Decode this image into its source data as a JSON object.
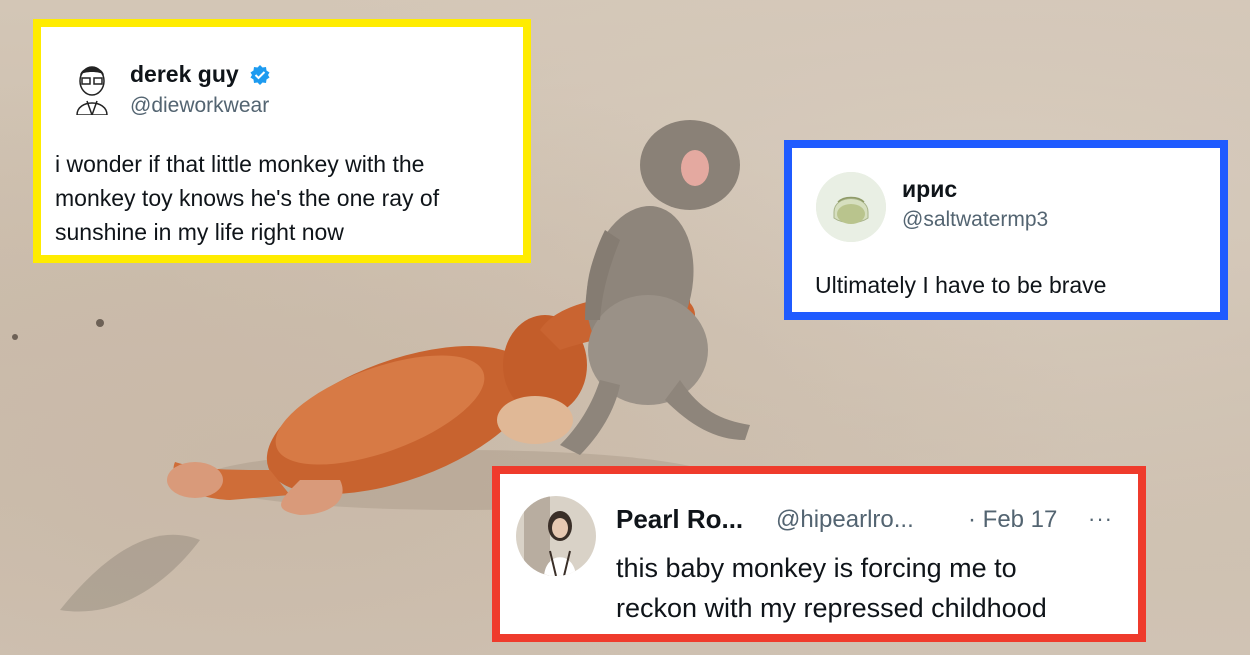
{
  "tweets": {
    "derek": {
      "name": "derek guy",
      "handle": "@dieworkwear",
      "text_lines": [
        "i wonder if that little monkey with the",
        "monkey toy knows he's the one ray of",
        "sunshine in my life right now"
      ],
      "verified": true,
      "border_color": "#ffec00"
    },
    "iris": {
      "name": "ирис",
      "handle": "@saltwatermp3",
      "text": "Ultimately I have to be brave",
      "border_color": "#1f5bff"
    },
    "pearl": {
      "name": "Pearl Ro...",
      "handle": "@hipearlro...",
      "date": "· Feb 17",
      "more": "···",
      "text_lines": [
        "this baby monkey is forcing me to",
        "reckon with my repressed childhood"
      ],
      "border_color": "#ef3b2c"
    }
  },
  "icons": {
    "verified": "verified-badge-icon",
    "more": "more-options-icon"
  }
}
